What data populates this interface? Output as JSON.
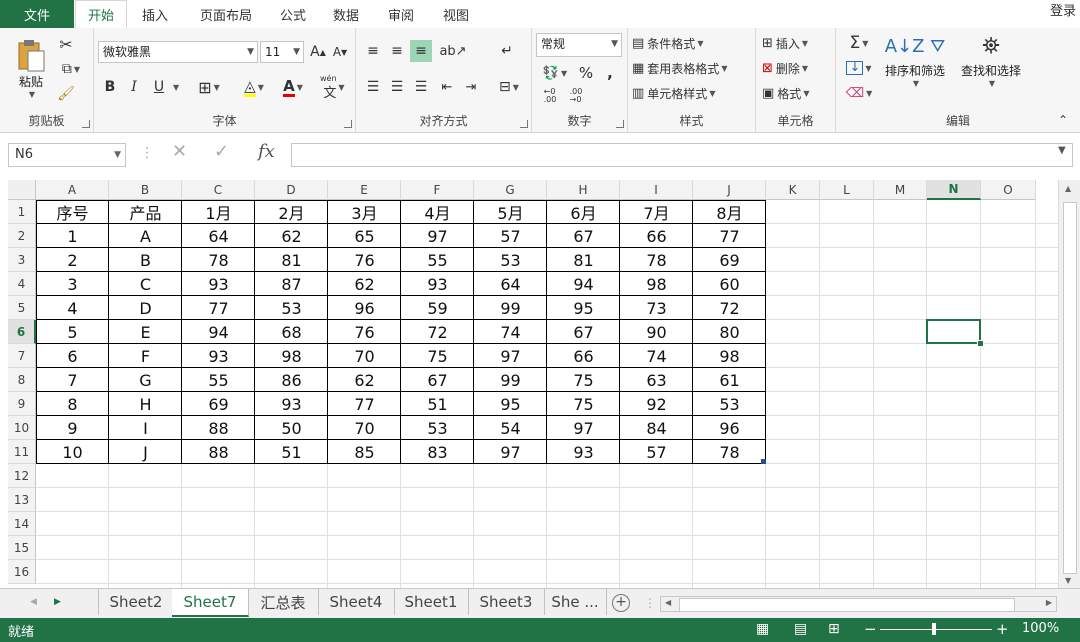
{
  "ribbon_tabs": [
    "文件",
    "开始",
    "插入",
    "页面布局",
    "公式",
    "数据",
    "审阅",
    "视图"
  ],
  "active_tab": "开始",
  "login": "登录",
  "clipboard": {
    "paste": "粘贴",
    "group": "剪贴板"
  },
  "font": {
    "name": "微软雅黑",
    "size": "11",
    "grow": "A",
    "shrink": "A",
    "bold": "B",
    "italic": "I",
    "underline": "U",
    "color_letter": "A",
    "phonetic": "wén",
    "group": "字体"
  },
  "alignment": {
    "group": "对齐方式"
  },
  "number": {
    "format": "常规",
    "percent": "%",
    "comma": ",",
    "group": "数字"
  },
  "styles": {
    "conditional": "条件格式",
    "table": "套用表格格式",
    "cell_styles": "单元格样式",
    "group": "样式"
  },
  "cells_group": {
    "insert": "插入",
    "delete": "删除",
    "format": "格式",
    "group": "单元格"
  },
  "editing": {
    "sigma": "Σ",
    "sort_filter": "排序和筛选",
    "find_select": "查找和选择",
    "group": "编辑"
  },
  "formula_bar": {
    "name_box": "N6",
    "fx": "fx",
    "formula": ""
  },
  "columns": [
    "A",
    "B",
    "C",
    "D",
    "E",
    "F",
    "G",
    "H",
    "I",
    "J",
    "K",
    "L",
    "M",
    "N",
    "O"
  ],
  "selected_column": "N",
  "row_numbers": [
    "1",
    "2",
    "3",
    "4",
    "5",
    "6",
    "7",
    "8",
    "9",
    "10",
    "11",
    "12",
    "13",
    "14",
    "15",
    "16"
  ],
  "selected_row": "6",
  "table": {
    "headers": [
      "序号",
      "产品",
      "1月",
      "2月",
      "3月",
      "4月",
      "5月",
      "6月",
      "7月",
      "8月"
    ],
    "rows": [
      [
        "1",
        "A",
        "64",
        "62",
        "65",
        "97",
        "57",
        "67",
        "66",
        "77"
      ],
      [
        "2",
        "B",
        "78",
        "81",
        "76",
        "55",
        "53",
        "81",
        "78",
        "69"
      ],
      [
        "3",
        "C",
        "93",
        "87",
        "62",
        "93",
        "64",
        "94",
        "98",
        "60"
      ],
      [
        "4",
        "D",
        "77",
        "53",
        "96",
        "59",
        "99",
        "95",
        "73",
        "72"
      ],
      [
        "5",
        "E",
        "94",
        "68",
        "76",
        "72",
        "74",
        "67",
        "90",
        "80"
      ],
      [
        "6",
        "F",
        "93",
        "98",
        "70",
        "75",
        "97",
        "66",
        "74",
        "98"
      ],
      [
        "7",
        "G",
        "55",
        "86",
        "62",
        "67",
        "99",
        "75",
        "63",
        "61"
      ],
      [
        "8",
        "H",
        "69",
        "93",
        "77",
        "51",
        "95",
        "75",
        "92",
        "53"
      ],
      [
        "9",
        "I",
        "88",
        "50",
        "70",
        "53",
        "54",
        "97",
        "84",
        "96"
      ],
      [
        "10",
        "J",
        "88",
        "51",
        "85",
        "83",
        "97",
        "93",
        "57",
        "78"
      ]
    ]
  },
  "sheet_tabs": [
    "Sheet2",
    "Sheet7",
    "汇总表",
    "Sheet4",
    "Sheet1",
    "Sheet3",
    "She ..."
  ],
  "active_sheet": "Sheet7",
  "status": {
    "ready": "就绪",
    "zoom": "100%",
    "minus": "−",
    "plus": "+"
  },
  "colors": {
    "accent": "#217346",
    "grid": "#e0e0e0"
  }
}
